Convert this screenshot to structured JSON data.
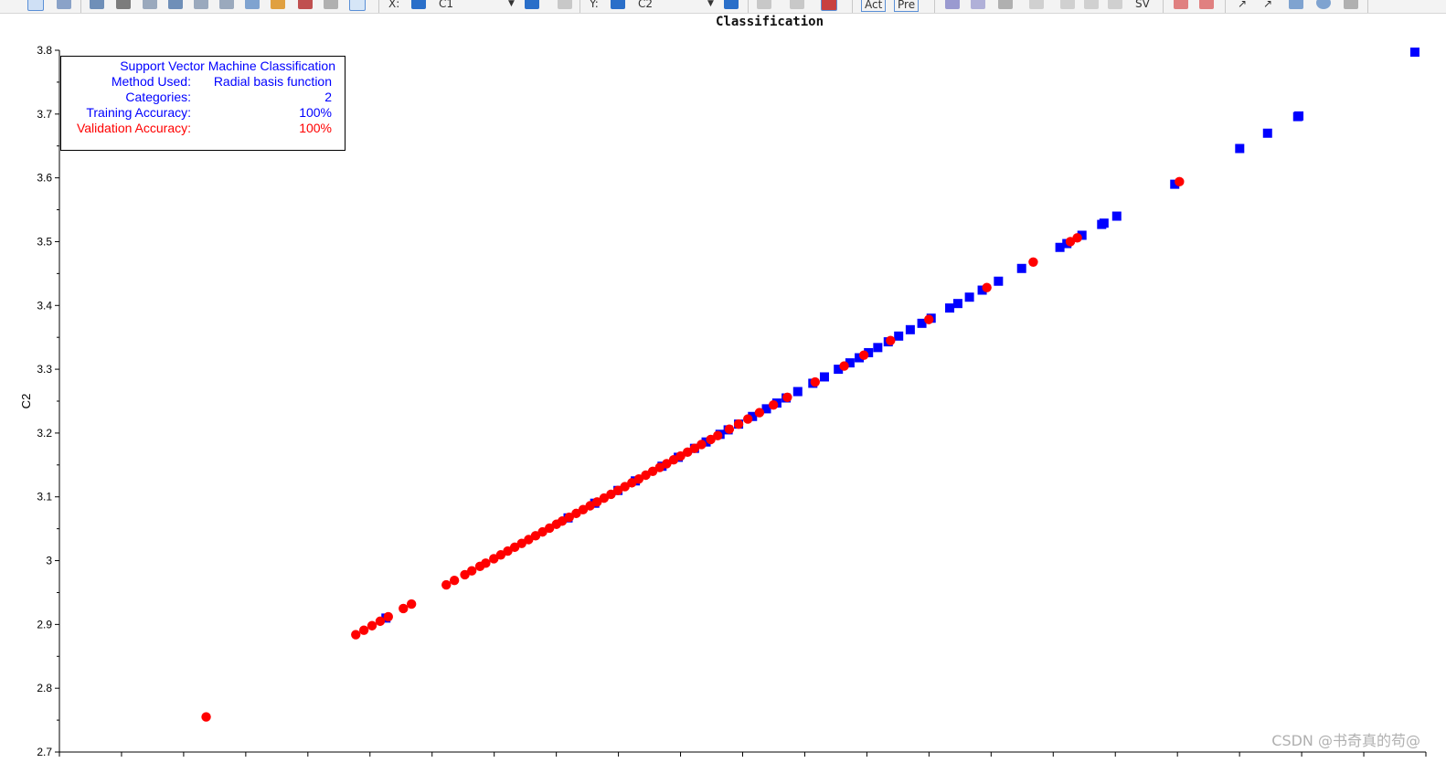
{
  "toolbar": {
    "x_label": "X:",
    "x_value": "C1",
    "y_label": "Y:",
    "y_value": "C2",
    "act_label": "Act",
    "pre_label": "Pre",
    "sv_label": "SV"
  },
  "info_box": {
    "title": "Support Vector Machine Classification",
    "rows": [
      {
        "label": "Method Used:",
        "value": "Radial basis function",
        "color": "#0000ff"
      },
      {
        "label": "Categories:",
        "value": "2",
        "color": "#0000ff"
      },
      {
        "label": "Training Accuracy:",
        "value": "100%",
        "color": "#0000ff"
      },
      {
        "label": "Validation Accuracy:",
        "value": "100%",
        "color": "#ff0000"
      }
    ]
  },
  "watermark": "CSDN @书奇真的苟@",
  "chart_data": {
    "type": "scatter",
    "title": "Classification",
    "xlabel": "",
    "ylabel": "C2",
    "ylim": [
      2.7,
      3.8
    ],
    "yticks": [
      "2.7",
      "2.8",
      "2.9",
      "3",
      "3.1",
      "3.2",
      "3.3",
      "3.4",
      "3.5",
      "3.6",
      "3.7",
      "3.8"
    ],
    "x_tick_count": 23,
    "grid": false,
    "series": [
      {
        "marker": "circle",
        "color": "#ff0000",
        "points": [
          [
            2.755,
            2.755
          ],
          [
            2.884,
            2.884
          ],
          [
            2.891,
            2.891
          ],
          [
            2.898,
            2.898
          ],
          [
            2.905,
            2.905
          ],
          [
            2.912,
            2.912
          ],
          [
            2.925,
            2.925
          ],
          [
            2.932,
            2.932
          ],
          [
            2.962,
            2.962
          ],
          [
            2.969,
            2.969
          ],
          [
            2.978,
            2.978
          ],
          [
            2.984,
            2.984
          ],
          [
            2.991,
            2.991
          ],
          [
            2.996,
            2.996
          ],
          [
            3.003,
            3.003
          ],
          [
            3.009,
            3.009
          ],
          [
            3.015,
            3.015
          ],
          [
            3.021,
            3.021
          ],
          [
            3.027,
            3.027
          ],
          [
            3.033,
            3.033
          ],
          [
            3.039,
            3.039
          ],
          [
            3.045,
            3.045
          ],
          [
            3.051,
            3.051
          ],
          [
            3.057,
            3.057
          ],
          [
            3.062,
            3.062
          ],
          [
            3.068,
            3.068
          ],
          [
            3.074,
            3.074
          ],
          [
            3.08,
            3.08
          ],
          [
            3.086,
            3.086
          ],
          [
            3.092,
            3.092
          ],
          [
            3.098,
            3.098
          ],
          [
            3.104,
            3.104
          ],
          [
            3.11,
            3.11
          ],
          [
            3.116,
            3.116
          ],
          [
            3.122,
            3.122
          ],
          [
            3.128,
            3.128
          ],
          [
            3.134,
            3.134
          ],
          [
            3.14,
            3.14
          ],
          [
            3.146,
            3.146
          ],
          [
            3.152,
            3.152
          ],
          [
            3.158,
            3.158
          ],
          [
            3.164,
            3.164
          ],
          [
            3.17,
            3.17
          ],
          [
            3.176,
            3.176
          ],
          [
            3.182,
            3.182
          ],
          [
            3.19,
            3.19
          ],
          [
            3.196,
            3.196
          ],
          [
            3.206,
            3.206
          ],
          [
            3.214,
            3.214
          ],
          [
            3.222,
            3.222
          ],
          [
            3.232,
            3.232
          ],
          [
            3.244,
            3.244
          ],
          [
            3.256,
            3.256
          ],
          [
            3.28,
            3.28
          ],
          [
            3.305,
            3.305
          ],
          [
            3.322,
            3.322
          ],
          [
            3.345,
            3.345
          ],
          [
            3.378,
            3.378
          ],
          [
            3.428,
            3.428
          ],
          [
            3.468,
            3.468
          ],
          [
            3.5,
            3.5
          ],
          [
            3.506,
            3.506
          ],
          [
            3.594,
            3.594
          ]
        ]
      },
      {
        "marker": "square",
        "color": "#0000ff",
        "points": [
          [
            2.91,
            2.91
          ],
          [
            3.067,
            3.067
          ],
          [
            3.09,
            3.09
          ],
          [
            3.11,
            3.11
          ],
          [
            3.125,
            3.125
          ],
          [
            3.148,
            3.148
          ],
          [
            3.162,
            3.162
          ],
          [
            3.176,
            3.176
          ],
          [
            3.186,
            3.186
          ],
          [
            3.198,
            3.198
          ],
          [
            3.205,
            3.205
          ],
          [
            3.214,
            3.214
          ],
          [
            3.226,
            3.226
          ],
          [
            3.238,
            3.238
          ],
          [
            3.247,
            3.247
          ],
          [
            3.255,
            3.255
          ],
          [
            3.265,
            3.265
          ],
          [
            3.278,
            3.278
          ],
          [
            3.288,
            3.288
          ],
          [
            3.3,
            3.3
          ],
          [
            3.31,
            3.31
          ],
          [
            3.318,
            3.318
          ],
          [
            3.326,
            3.326
          ],
          [
            3.334,
            3.334
          ],
          [
            3.343,
            3.343
          ],
          [
            3.352,
            3.352
          ],
          [
            3.362,
            3.362
          ],
          [
            3.372,
            3.372
          ],
          [
            3.38,
            3.38
          ],
          [
            3.396,
            3.396
          ],
          [
            3.403,
            3.403
          ],
          [
            3.413,
            3.413
          ],
          [
            3.424,
            3.424
          ],
          [
            3.438,
            3.438
          ],
          [
            3.458,
            3.458
          ],
          [
            3.491,
            3.491
          ],
          [
            3.497,
            3.497
          ],
          [
            3.51,
            3.51
          ],
          [
            3.527,
            3.527
          ],
          [
            3.529,
            3.529
          ],
          [
            3.54,
            3.54
          ],
          [
            3.59,
            3.59
          ],
          [
            3.646,
            3.646
          ],
          [
            3.67,
            3.67
          ],
          [
            3.696,
            3.696
          ],
          [
            3.697,
            3.697
          ],
          [
            3.797,
            3.797
          ]
        ]
      }
    ]
  }
}
